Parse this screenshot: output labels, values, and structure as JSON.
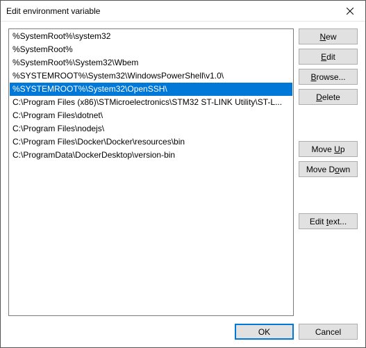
{
  "window": {
    "title": "Edit environment variable"
  },
  "list": {
    "items": [
      "%SystemRoot%\\system32",
      "%SystemRoot%",
      "%SystemRoot%\\System32\\Wbem",
      "%SYSTEMROOT%\\System32\\WindowsPowerShell\\v1.0\\",
      "%SYSTEMROOT%\\System32\\OpenSSH\\",
      "C:\\Program Files (x86)\\STMicroelectronics\\STM32 ST-LINK Utility\\ST-L...",
      "C:\\Program Files\\dotnet\\",
      "C:\\Program Files\\nodejs\\",
      "C:\\Program Files\\Docker\\Docker\\resources\\bin",
      "C:\\ProgramData\\DockerDesktop\\version-bin"
    ],
    "selected_index": 4
  },
  "buttons": {
    "new": {
      "pre": "",
      "mn": "N",
      "post": "ew"
    },
    "edit": {
      "pre": "",
      "mn": "E",
      "post": "dit"
    },
    "browse": {
      "pre": "",
      "mn": "B",
      "post": "rowse..."
    },
    "delete": {
      "pre": "",
      "mn": "D",
      "post": "elete"
    },
    "moveup": {
      "pre": "Move ",
      "mn": "U",
      "post": "p"
    },
    "movedown": {
      "pre": "Move D",
      "mn": "o",
      "post": "wn"
    },
    "edittext": {
      "pre": "Edit ",
      "mn": "t",
      "post": "ext..."
    },
    "ok": {
      "pre": "OK",
      "mn": "",
      "post": ""
    },
    "cancel": {
      "pre": "Cancel",
      "mn": "",
      "post": ""
    }
  }
}
